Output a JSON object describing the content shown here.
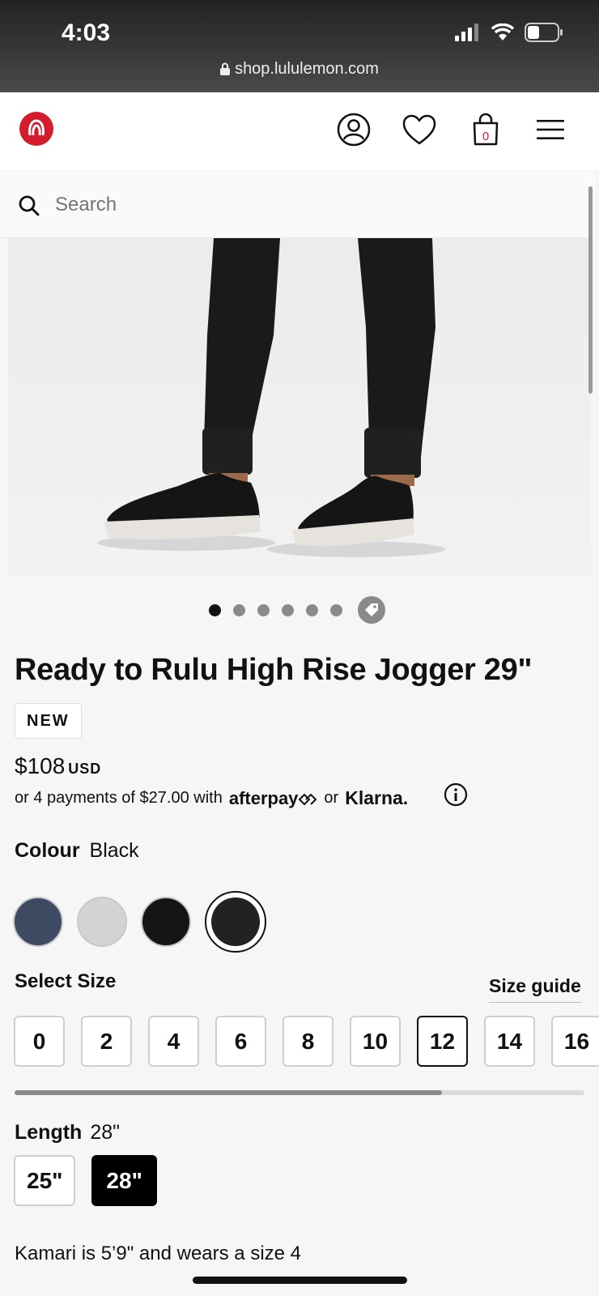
{
  "status_bar": {
    "time": "4:03",
    "url": "shop.lululemon.com"
  },
  "search": {
    "placeholder": "Search"
  },
  "cart": {
    "count": "0"
  },
  "carousel": {
    "total_dots": 6,
    "active_index": 0
  },
  "product": {
    "title": "Ready to Rulu High Rise Jogger 29\"",
    "badge": "NEW",
    "price": "$108",
    "currency": "USD",
    "installments_text": "or 4 payments of $27.00 with",
    "afterpay_label": "afterpay",
    "or_text": "or",
    "klarna_label": "Klarna."
  },
  "colour": {
    "label": "Colour",
    "selected": "Black",
    "swatches": [
      {
        "name": "heathered-navy",
        "color": "#3d4a62"
      },
      {
        "name": "heathered-grey",
        "color": "#d3d3d5"
      },
      {
        "name": "black-alt",
        "color": "#151515"
      },
      {
        "name": "black",
        "color": "#222222",
        "selected": true
      }
    ]
  },
  "size": {
    "title": "Select Size",
    "guide_label": "Size guide",
    "options": [
      "0",
      "2",
      "4",
      "6",
      "8",
      "10",
      "12",
      "14",
      "16"
    ],
    "selected": "12",
    "scroll_fraction": 0.75
  },
  "length": {
    "label": "Length",
    "selected": "28\"",
    "options": [
      "25\"",
      "28\""
    ]
  },
  "model_note": "Kamari is 5’9\" and wears a size 4",
  "colors": {
    "brand_red": "#d31c2c"
  }
}
